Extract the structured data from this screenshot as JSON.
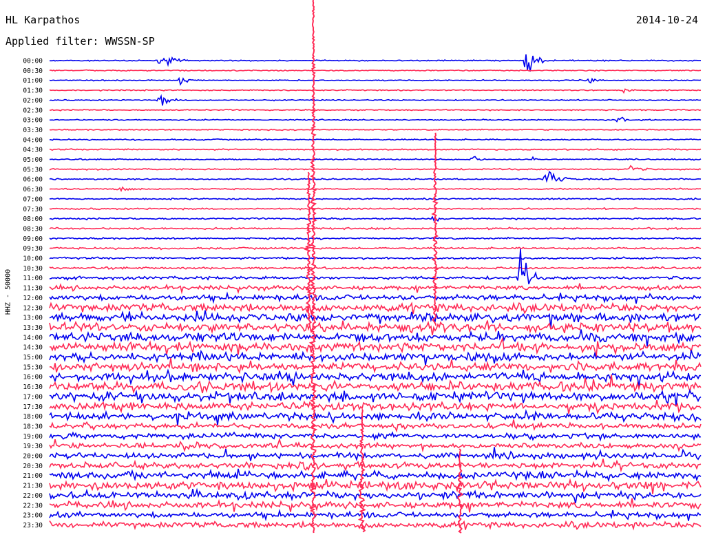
{
  "header": {
    "station": "HL Karpathos",
    "date": "2014-10-24",
    "filter_label": "Applied filter: WWSSN-SP"
  },
  "axis": {
    "channel_label": "HHZ - 50000"
  },
  "colors": {
    "series_a": "#0000ee",
    "series_b": "#ff2a55",
    "background": "#ffffff"
  },
  "chart_data": {
    "type": "line",
    "title": "HL Karpathos",
    "subtitle": "Applied filter: WWSSN-SP",
    "ylabel": "HHZ - 50000",
    "row_labels": [
      "00:00",
      "00:30",
      "01:00",
      "01:30",
      "02:00",
      "02:30",
      "03:00",
      "03:30",
      "04:00",
      "04:30",
      "05:00",
      "05:30",
      "06:00",
      "06:30",
      "07:00",
      "07:30",
      "08:00",
      "08:30",
      "09:00",
      "09:30",
      "10:00",
      "10:30",
      "11:00",
      "11:30",
      "12:00",
      "12:30",
      "13:00",
      "13:30",
      "14:00",
      "14:30",
      "15:00",
      "15:30",
      "16:00",
      "16:30",
      "17:00",
      "17:30",
      "18:00",
      "18:30",
      "19:00",
      "19:30",
      "20:00",
      "20:30",
      "21:00",
      "21:30",
      "22:00",
      "22:30",
      "23:00",
      "23:30"
    ],
    "series_colors": [
      "blue",
      "red"
    ],
    "noise_level": [
      0.6,
      0.6,
      0.6,
      0.6,
      0.6,
      0.6,
      0.6,
      0.6,
      0.7,
      0.7,
      0.7,
      0.7,
      0.7,
      0.7,
      0.8,
      0.8,
      0.9,
      0.9,
      1.0,
      1.0,
      1.1,
      1.2,
      1.6,
      2.2,
      3.0,
      4.2,
      4.5,
      4.6,
      4.8,
      4.6,
      4.4,
      4.4,
      4.6,
      4.8,
      4.8,
      4.2,
      3.6,
      3.0,
      2.8,
      2.8,
      3.0,
      3.2,
      4.0,
      4.4,
      3.8,
      3.4,
      3.0,
      3.2
    ],
    "events": [
      {
        "row": 0,
        "x": 0.17,
        "amplitude": 10,
        "duration": 0.04
      },
      {
        "row": 0,
        "x": 0.73,
        "amplitude": 28,
        "duration": 0.03
      },
      {
        "row": 2,
        "x": 0.2,
        "amplitude": 8,
        "duration": 0.02
      },
      {
        "row": 2,
        "x": 0.83,
        "amplitude": 12,
        "duration": 0.02
      },
      {
        "row": 3,
        "x": 0.88,
        "amplitude": 7,
        "duration": 0.02
      },
      {
        "row": 4,
        "x": 0.17,
        "amplitude": 9,
        "duration": 0.03
      },
      {
        "row": 6,
        "x": 0.87,
        "amplitude": 6,
        "duration": 0.02
      },
      {
        "row": 10,
        "x": 0.65,
        "amplitude": 5,
        "duration": 0.02
      },
      {
        "row": 10,
        "x": 0.74,
        "amplitude": 5,
        "duration": 0.02
      },
      {
        "row": 11,
        "x": 0.89,
        "amplitude": 6,
        "duration": 0.03
      },
      {
        "row": 12,
        "x": 0.76,
        "amplitude": 16,
        "duration": 0.04
      },
      {
        "row": 13,
        "x": 0.11,
        "amplitude": 6,
        "duration": 0.03
      },
      {
        "row": 16,
        "x": 0.59,
        "amplitude": 5,
        "duration": 0.02
      },
      {
        "row": 22,
        "x": 0.72,
        "amplitude": 40,
        "duration": 0.03
      }
    ],
    "spikes": [
      {
        "x": 0.405,
        "from_row": 0,
        "to_row": 47,
        "color": "red"
      },
      {
        "x": 0.398,
        "from_row": 12,
        "to_row": 26,
        "color": "red"
      },
      {
        "x": 0.592,
        "from_row": 8,
        "to_row": 26,
        "color": "red"
      },
      {
        "x": 0.48,
        "from_row": 36,
        "to_row": 47,
        "color": "red"
      },
      {
        "x": 0.63,
        "from_row": 40,
        "to_row": 47,
        "color": "red"
      }
    ]
  }
}
